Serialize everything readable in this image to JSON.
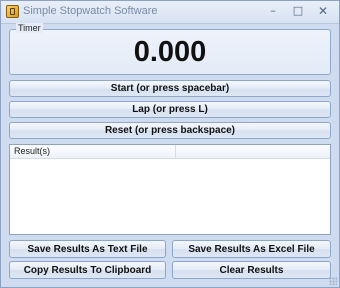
{
  "window": {
    "title": "Simple Stopwatch Software",
    "minimize_glyph": "–",
    "maximize_glyph": "□",
    "close_glyph": "✕"
  },
  "timer": {
    "label": "Timer",
    "value": "0.000"
  },
  "buttons": {
    "start": "Start (or press spacebar)",
    "lap": "Lap (or press L)",
    "reset": "Reset (or press backspace)",
    "save_text": "Save Results As Text File",
    "save_excel": "Save Results As Excel File",
    "copy": "Copy Results To Clipboard",
    "clear": "Clear Results"
  },
  "results": {
    "columns": [
      "Result(s)",
      ""
    ],
    "rows": []
  },
  "icons": {
    "app": "stopwatch-app-icon"
  }
}
